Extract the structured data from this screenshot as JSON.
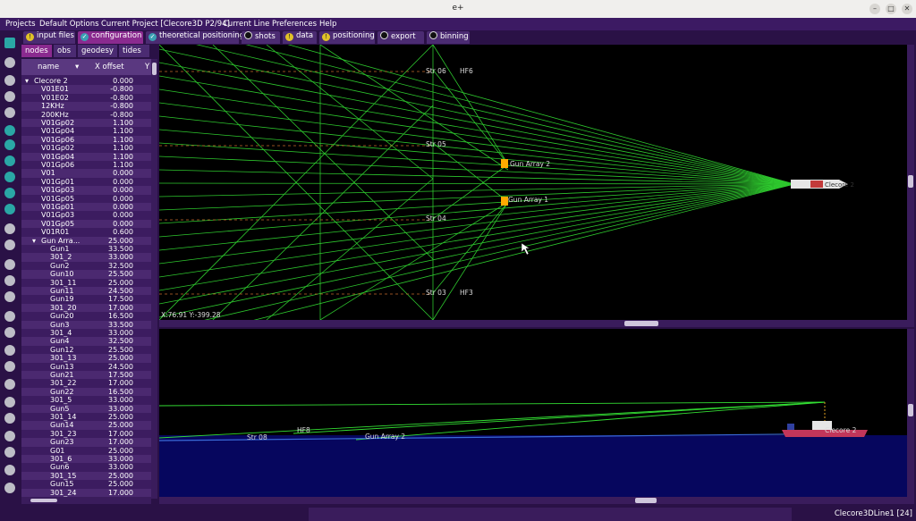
{
  "window": {
    "title": "e+"
  },
  "menu": [
    "Projects",
    "Default Options",
    "Current Project [Clecore3D P2/94]",
    "Current Line",
    "Preferences",
    "Help"
  ],
  "tabs": [
    {
      "label": "input files",
      "status": "warn"
    },
    {
      "label": "configuration",
      "status": "ok",
      "active": true
    },
    {
      "label": "theoretical positioning",
      "status": "ok"
    },
    {
      "label": "shots",
      "status": "rec"
    },
    {
      "label": "data",
      "status": "warn"
    },
    {
      "label": "positioning",
      "status": "warn"
    },
    {
      "label": "export",
      "status": "rec"
    },
    {
      "label": "binning",
      "status": "rec"
    }
  ],
  "subtabs": [
    "nodes",
    "obs",
    "geodesy",
    "tides"
  ],
  "tree": {
    "col_name": "name",
    "col_x": "X offset",
    "col_y": "Y",
    "rows": [
      {
        "name": "Clecore 2",
        "x": "0.000",
        "level": 0,
        "expand": "▾"
      },
      {
        "name": "V01E01",
        "x": "-0.800",
        "level": 1
      },
      {
        "name": "V01E02",
        "x": "-0.800",
        "level": 1
      },
      {
        "name": "12KHz",
        "x": "-0.800",
        "level": 1
      },
      {
        "name": "200KHz",
        "x": "-0.800",
        "level": 1
      },
      {
        "name": "V01Gp02",
        "x": "1.100",
        "level": 1
      },
      {
        "name": "V01Gp04",
        "x": "1.100",
        "level": 1
      },
      {
        "name": "V01Gp06",
        "x": "1.100",
        "level": 1
      },
      {
        "name": "V01Gp02",
        "x": "1.100",
        "level": 1
      },
      {
        "name": "V01Gp04",
        "x": "1.100",
        "level": 1
      },
      {
        "name": "V01Gp06",
        "x": "1.100",
        "level": 1
      },
      {
        "name": "V01",
        "x": "0.000",
        "level": 1
      },
      {
        "name": "V01Gp01",
        "x": "0.000",
        "level": 1
      },
      {
        "name": "V01Gp03",
        "x": "0.000",
        "level": 1
      },
      {
        "name": "V01Gp05",
        "x": "0.000",
        "level": 1
      },
      {
        "name": "V01Gp01",
        "x": "0.000",
        "level": 1
      },
      {
        "name": "V01Gp03",
        "x": "0.000",
        "level": 1
      },
      {
        "name": "V01Gp05",
        "x": "0.000",
        "level": 1
      },
      {
        "name": "V01R01",
        "x": "0.600",
        "level": 1
      },
      {
        "name": "Gun Arra...",
        "x": "25.000",
        "level": 1,
        "expand": "▾"
      },
      {
        "name": "Gun1",
        "x": "33.500",
        "level": 2
      },
      {
        "name": "301_2",
        "x": "33.000",
        "level": 2
      },
      {
        "name": "Gun2",
        "x": "32.500",
        "level": 2
      },
      {
        "name": "Gun10",
        "x": "25.500",
        "level": 2
      },
      {
        "name": "301_11",
        "x": "25.000",
        "level": 2
      },
      {
        "name": "Gun11",
        "x": "24.500",
        "level": 2
      },
      {
        "name": "Gun19",
        "x": "17.500",
        "level": 2
      },
      {
        "name": "301_20",
        "x": "17.000",
        "level": 2
      },
      {
        "name": "Gun20",
        "x": "16.500",
        "level": 2
      },
      {
        "name": "Gun3",
        "x": "33.500",
        "level": 2
      },
      {
        "name": "301_4",
        "x": "33.000",
        "level": 2
      },
      {
        "name": "Gun4",
        "x": "32.500",
        "level": 2
      },
      {
        "name": "Gun12",
        "x": "25.500",
        "level": 2
      },
      {
        "name": "301_13",
        "x": "25.000",
        "level": 2
      },
      {
        "name": "Gun13",
        "x": "24.500",
        "level": 2
      },
      {
        "name": "Gun21",
        "x": "17.500",
        "level": 2
      },
      {
        "name": "301_22",
        "x": "17.000",
        "level": 2
      },
      {
        "name": "Gun22",
        "x": "16.500",
        "level": 2
      },
      {
        "name": "301_5",
        "x": "33.000",
        "level": 2
      },
      {
        "name": "Gun5",
        "x": "33.000",
        "level": 2
      },
      {
        "name": "301_14",
        "x": "25.000",
        "level": 2
      },
      {
        "name": "Gun14",
        "x": "25.000",
        "level": 2
      },
      {
        "name": "301_23",
        "x": "17.000",
        "level": 2
      },
      {
        "name": "Gun23",
        "x": "17.000",
        "level": 2
      },
      {
        "name": "G01",
        "x": "25.000",
        "level": 2
      },
      {
        "name": "301_6",
        "x": "33.000",
        "level": 2
      },
      {
        "name": "Gun6",
        "x": "33.000",
        "level": 2
      },
      {
        "name": "301_15",
        "x": "25.000",
        "level": 2
      },
      {
        "name": "Gun15",
        "x": "25.000",
        "level": 2
      },
      {
        "name": "301_24",
        "x": "17.000",
        "level": 2
      }
    ]
  },
  "plan_view": {
    "labels": [
      "Str 06",
      "HF6",
      "Str 05",
      "Gun Array 2",
      "Gun Array 1",
      "Str 04",
      "Str 03",
      "HF3",
      "Clecore 2"
    ],
    "coords": "X:76.91 Y:-399.28"
  },
  "profile_view": {
    "labels": [
      "Str 08",
      "HF8",
      "Gun Array 2",
      "Clecore 2"
    ]
  },
  "status": {
    "line": "Clecore3DLine1 [24]"
  },
  "colors": {
    "accent": "#8a2a8f",
    "panel": "#3c1c60",
    "ray": "#33dd33",
    "sea": "#06065e"
  }
}
